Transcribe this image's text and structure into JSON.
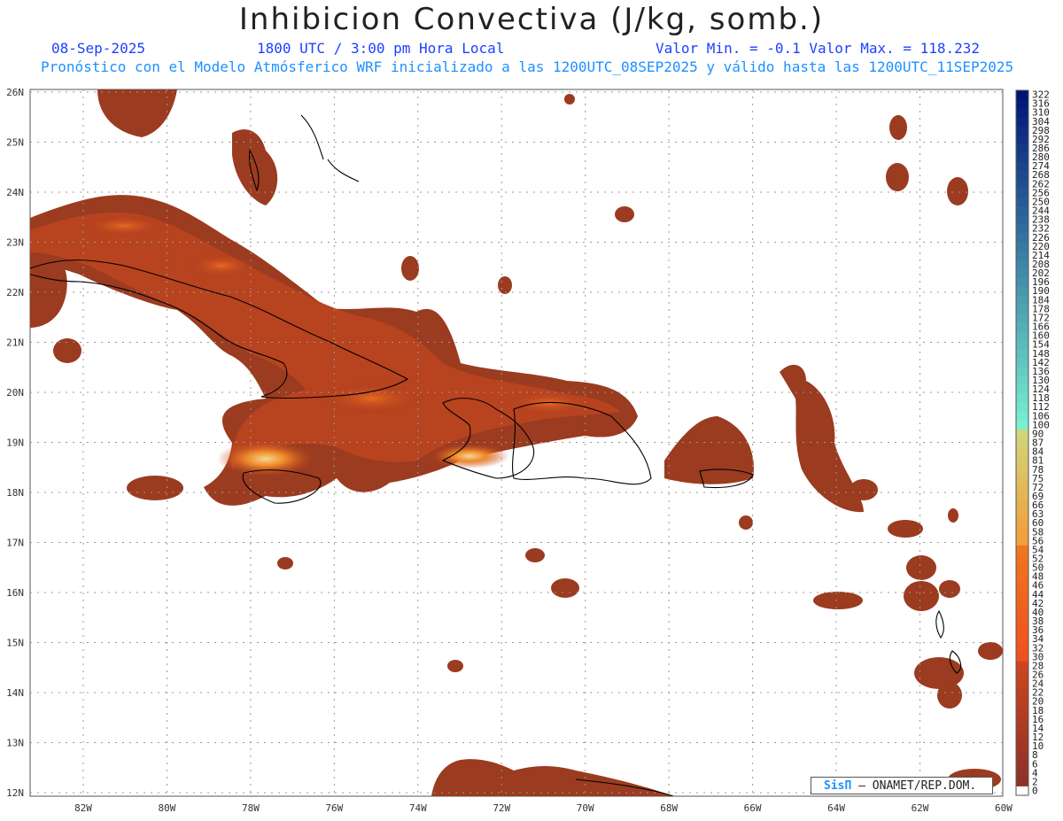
{
  "header": {
    "title": "Inhibicion Convectiva (J/kg, somb.)",
    "date": "08-Sep-2025",
    "time": "1800 UTC / 3:00 pm Hora Local",
    "minmax": "Valor Min. = -0.1  Valor Max. = 118.232",
    "model_line": "Pronóstico con el Modelo Atmósferico WRF inicializado a las 1200UTC_08SEP2025 y válido hasta las  1200UTC_11SEP2025"
  },
  "map": {
    "lon_labels": [
      "82W",
      "80W",
      "78W",
      "76W",
      "74W",
      "72W",
      "70W",
      "68W",
      "66W",
      "64W",
      "62W",
      "60W"
    ],
    "lat_labels": [
      "26N",
      "25N",
      "24N",
      "23N",
      "22N",
      "21N",
      "20N",
      "19N",
      "18N",
      "17N",
      "16N",
      "15N",
      "14N",
      "13N",
      "12N"
    ],
    "field_colors": {
      "low": "#8b3a22",
      "mid": "#c4421b",
      "high": "#f07a22",
      "peak": "#f2d890"
    }
  },
  "colorbar": {
    "labels": [
      "322",
      "316",
      "310",
      "304",
      "298",
      "292",
      "286",
      "280",
      "274",
      "268",
      "262",
      "256",
      "250",
      "244",
      "238",
      "232",
      "226",
      "220",
      "214",
      "208",
      "202",
      "196",
      "190",
      "184",
      "178",
      "172",
      "166",
      "160",
      "154",
      "148",
      "142",
      "136",
      "130",
      "124",
      "118",
      "112",
      "106",
      "100",
      "90",
      "87",
      "84",
      "81",
      "78",
      "75",
      "72",
      "69",
      "66",
      "63",
      "60",
      "58",
      "56",
      "54",
      "52",
      "50",
      "48",
      "46",
      "44",
      "42",
      "40",
      "38",
      "36",
      "34",
      "32",
      "30",
      "28",
      "26",
      "24",
      "22",
      "20",
      "18",
      "16",
      "14",
      "12",
      "10",
      "8",
      "6",
      "4",
      "2",
      "0"
    ]
  },
  "credit": {
    "logo": "SisΠ",
    "text": "– ONAMET/REP.DOM."
  }
}
